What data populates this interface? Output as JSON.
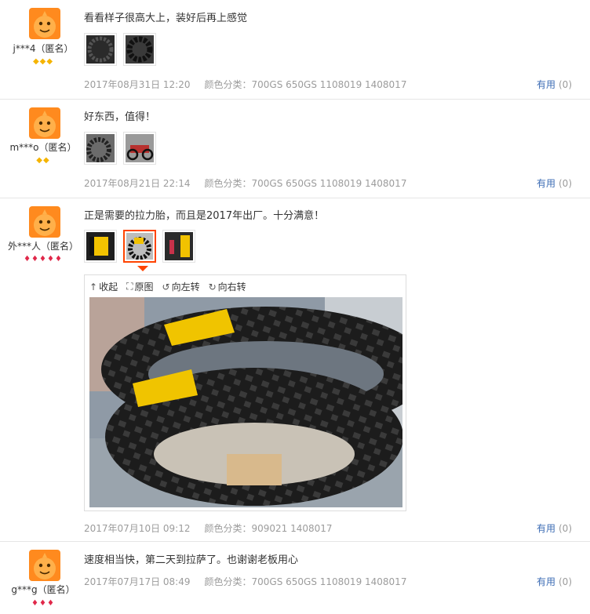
{
  "reviews": [
    {
      "user": "j***4（匿名）",
      "badge": "◆◆◆",
      "text": "看看样子很高大上，装好后再上感觉",
      "date": "2017年08月31日 12:20",
      "spec": "颜色分类：700GS 650GS 1108019 1408017",
      "useful_label": "有用",
      "useful_count": "(0)"
    },
    {
      "user": "m***o（匿名）",
      "badge": "◆◆",
      "text": "好东西，值得！",
      "date": "2017年08月21日 22:14",
      "spec": "颜色分类：700GS 650GS 1108019 1408017",
      "useful_label": "有用",
      "useful_count": "(0)"
    },
    {
      "user": "外***人（匿名）",
      "badge": "♦♦♦♦♦",
      "text": "正是需要的拉力胎，而且是2017年出厂。十分满意！",
      "date": "2017年07月10日 09:12",
      "spec": "颜色分类：909021 1408017",
      "useful_label": "有用",
      "useful_count": "(0)"
    },
    {
      "user": "g***g（匿名）",
      "badge": "♦♦♦",
      "text": "速度相当快，第二天到拉萨了。也谢谢老板用心",
      "date": "2017年07月17日 08:49",
      "spec": "颜色分类：700GS 650GS 1108019 1408017",
      "useful_label": "有用",
      "useful_count": "(0)"
    }
  ],
  "viewer": {
    "collapse": "收起",
    "original": "原图",
    "rotate_left": "向左转",
    "rotate_right": "向右转",
    "icons": [
      "arrow-up-icon",
      "expand-icon",
      "rotate-left-icon",
      "rotate-right-icon"
    ]
  },
  "colors": {
    "link": "#3c6cb4",
    "muted": "#9c9c9c",
    "active_thumb": "#ff4400",
    "badge_gold": "#f5b400",
    "badge_red": "#e0284a"
  }
}
